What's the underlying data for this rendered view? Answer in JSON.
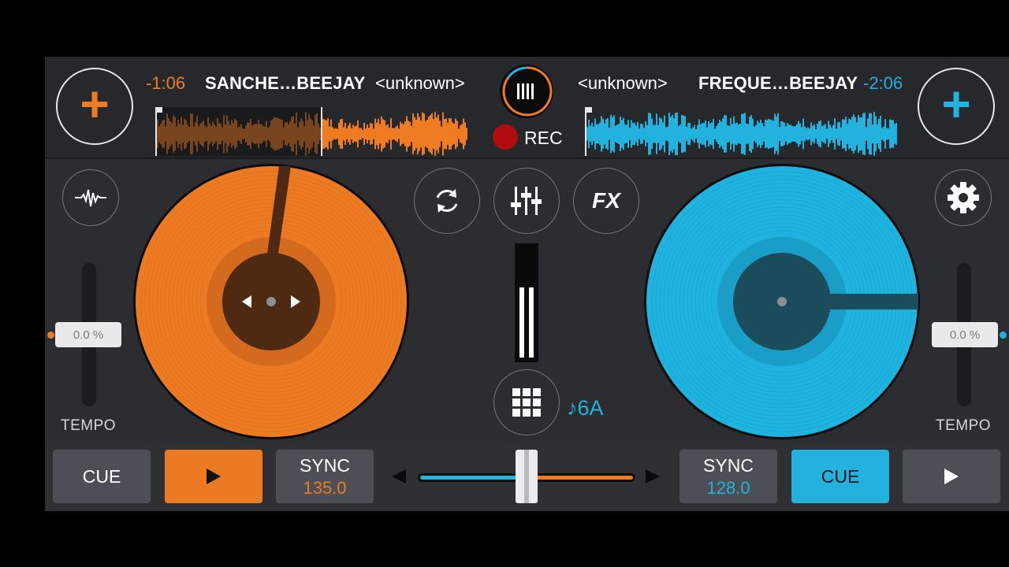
{
  "colors": {
    "left_accent": "#ef7b22",
    "right_accent": "#22b2dd",
    "background": "#2b2d30"
  },
  "left_deck": {
    "load_icon": "plus-icon",
    "time_remaining": "-1:06",
    "track_title": "SANCHE…BEEJAY",
    "track_artist": "<unknown>",
    "play_progress": 0.53,
    "analysis_icon": "waveform-pulse-icon",
    "tempo_value": "0.0 %",
    "tempo_label": "TEMPO",
    "cue_label": "CUE",
    "play_icon": "play-icon",
    "sync_label": "SYNC",
    "bpm": "135.0"
  },
  "right_deck": {
    "load_icon": "plus-icon",
    "time_remaining": "-2:06",
    "track_title": "FREQUE…BEEJAY",
    "track_artist": "<unknown>",
    "play_progress": 0.0,
    "settings_icon": "gear-icon",
    "tempo_value": "0.0 %",
    "tempo_label": "TEMPO",
    "cue_label": "CUE",
    "play_icon": "play-icon",
    "sync_label": "SYNC",
    "bpm": "128.0"
  },
  "center": {
    "rec_label": "REC",
    "loop_icon": "sync-arrows-icon",
    "mixer_icon": "sliders-icon",
    "fx_label": "FX",
    "sampler_icon": "grid-icon",
    "key_label": "♪6A",
    "crossfader_position": 0.5
  }
}
